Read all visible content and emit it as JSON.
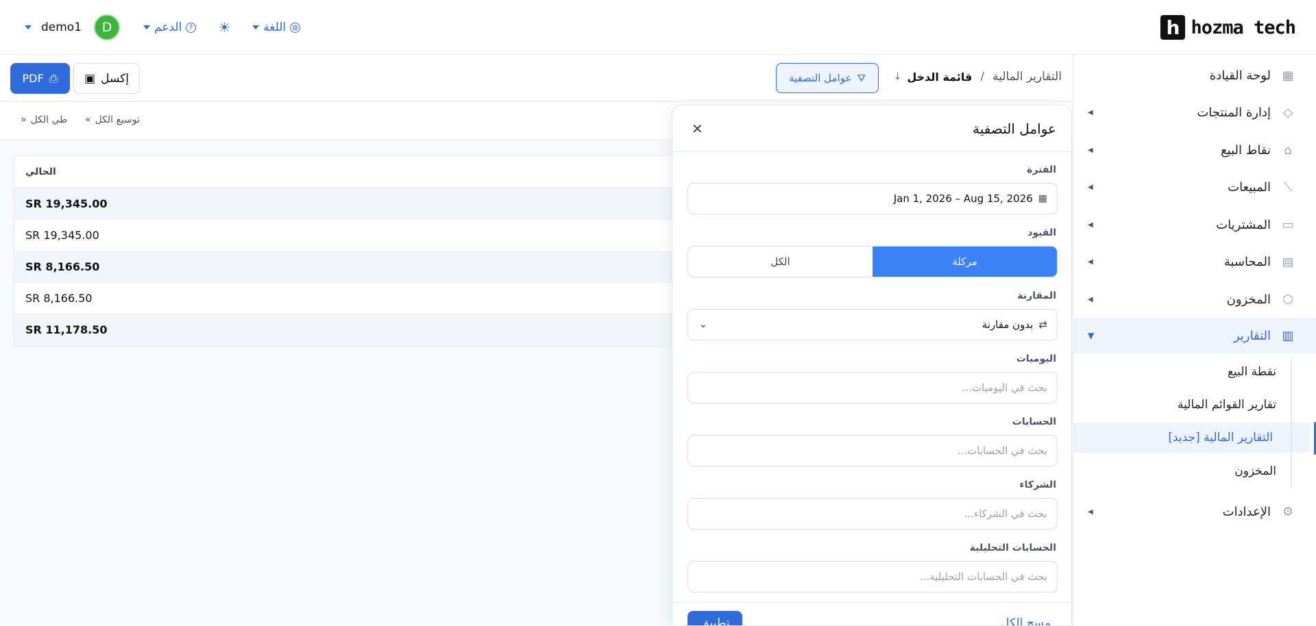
{
  "brand": {
    "logo_letter": "h",
    "name": "hozma tech"
  },
  "topbar": {
    "user_name": "demo1",
    "avatar_letter": "D",
    "support_label": "الدعم",
    "language_label": "اللغة",
    "theme_icon": "sun-icon"
  },
  "sidebar": {
    "items": [
      {
        "label": "لوحة القيادة",
        "icon": "dashboard-icon"
      },
      {
        "label": "إدارة المنتجات",
        "icon": "tag-icon"
      },
      {
        "label": "نقاط البيع",
        "icon": "store-icon"
      },
      {
        "label": "المبيعات",
        "icon": "chart-line-icon"
      },
      {
        "label": "المشتريات",
        "icon": "card-icon"
      },
      {
        "label": "المحاسبة",
        "icon": "building-icon"
      },
      {
        "label": "المخزون",
        "icon": "box-icon"
      },
      {
        "label": "التقارير",
        "icon": "report-icon"
      },
      {
        "label": "الإعدادات",
        "icon": "gear-icon"
      }
    ],
    "sub_items": [
      {
        "label": "نقطة البيع"
      },
      {
        "label": "تقارير القوائم المالية"
      },
      {
        "label": "التقارير المالية [جديد]"
      },
      {
        "label": "المخزون"
      }
    ]
  },
  "header": {
    "breadcrumb_root": "التقارير المالية",
    "breadcrumb_sep": "/",
    "breadcrumb_current": "قائمة الدخل",
    "filter_button": "عوامل التصفية",
    "pdf_button": "PDF",
    "excel_button": "إكسل"
  },
  "toolbar": {
    "expand_all": "توسيع الكل",
    "collapse_all": "طي الكل"
  },
  "table": {
    "column_current": "الحالي",
    "rows": [
      {
        "value": "SR 19,345.00",
        "bold": true
      },
      {
        "value": "SR 19,345.00",
        "bold": false
      },
      {
        "value": "SR 8,166.50",
        "bold": true
      },
      {
        "value": "SR 8,166.50",
        "bold": false
      },
      {
        "value": "SR 11,178.50",
        "bold": true
      }
    ]
  },
  "filters": {
    "title": "عوامل التصفية",
    "period_label": "الفترة",
    "period_value": "Jan 1, 2026 – Aug 15, 2026",
    "entries_label": "القيود",
    "entries_options": [
      "مركلة",
      "الكل"
    ],
    "entries_selected": "مركلة",
    "comparison_label": "المقارنة",
    "comparison_value": "بدون مقارنة",
    "journals_label": "اليوميات",
    "journals_placeholder": "بحث في اليوميات...",
    "accounts_label": "الحسابات",
    "accounts_placeholder": "بحث في الحسابات...",
    "partners_label": "الشركاء",
    "partners_placeholder": "بحث في الشركاء...",
    "analytic_label": "الحسابات التحليلية",
    "analytic_placeholder": "بحث في الحسابات التحليلية...",
    "apply_button": "تطبيق",
    "clear_all": "مسح الكل"
  },
  "colors": {
    "accent": "#2f6bd9",
    "avatar": "#3db53d"
  }
}
